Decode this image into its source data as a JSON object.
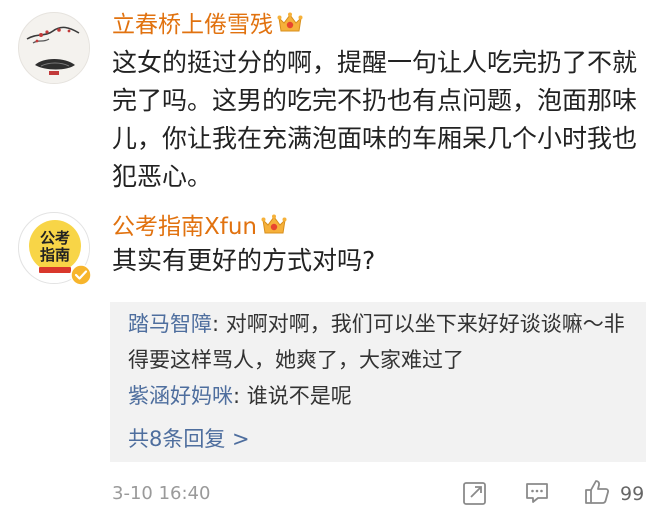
{
  "comments": [
    {
      "username": "立春桥上倦雪残",
      "badge": "crown-vip-icon",
      "avatar": "ink-painting-avatar",
      "text": "这女的挺过分的啊，提醒一句让人吃完扔了不就完了吗。这男的吃完不扔也有点问题，泡面那味儿，你让我在充满泡面味的车厢呆几个小时我也犯恶心。"
    },
    {
      "username": "公考指南Xfun",
      "badge": "crown-vip-icon",
      "avatar": {
        "line1": "公考",
        "line2": "指南",
        "verified": "verified-check-icon"
      },
      "text": "其实有更好的方式对吗?",
      "replies": [
        {
          "name": "踏马智障",
          "separator": ": ",
          "text": "对啊对啊，我们可以坐下来好好谈谈嘛～非得要这样骂人，她爽了，大家难过了"
        },
        {
          "name": "紫涵好妈咪",
          "separator": ": ",
          "text": "谁说不是呢"
        }
      ],
      "more_replies": "共8条回复 >",
      "timestamp": "3-10 16:40",
      "actions": {
        "share_icon": "share-icon",
        "reply_icon": "comment-icon",
        "like_icon": "thumbs-up-icon",
        "like_count": "99"
      }
    }
  ],
  "colors": {
    "username": "#e1720f",
    "reply_name": "#4e6e9e",
    "reply_bg": "#f2f2f2",
    "crown_gold": "#f6b13a",
    "crown_red": "#e8452f"
  }
}
